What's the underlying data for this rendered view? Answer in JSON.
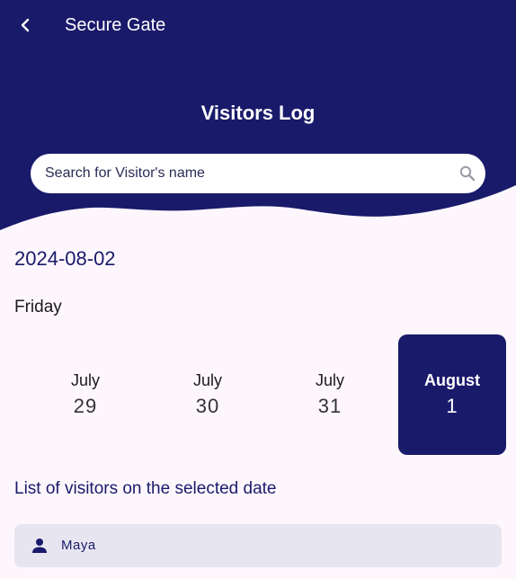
{
  "colors": {
    "primary": "#1a1a6b",
    "background": "#fdf7fd",
    "surface": "#e7e6f0"
  },
  "app_bar": {
    "back_icon": "chevron-left-icon",
    "title": "Secure Gate"
  },
  "header": {
    "page_title": "Visitors Log"
  },
  "search": {
    "placeholder": "Search for Visitor's name",
    "value": "",
    "icon": "search-icon"
  },
  "selected_date": {
    "date": "2024-08-02",
    "weekday": "Friday"
  },
  "date_strip": [
    {
      "month": "July",
      "day": "29",
      "selected": false
    },
    {
      "month": "July",
      "day": "30",
      "selected": false
    },
    {
      "month": "July",
      "day": "31",
      "selected": false
    },
    {
      "month": "August",
      "day": "1",
      "selected": true
    }
  ],
  "visitors_section": {
    "title": "List of visitors on the selected date",
    "visitors": [
      {
        "name": "Maya",
        "icon": "person-icon"
      }
    ]
  }
}
